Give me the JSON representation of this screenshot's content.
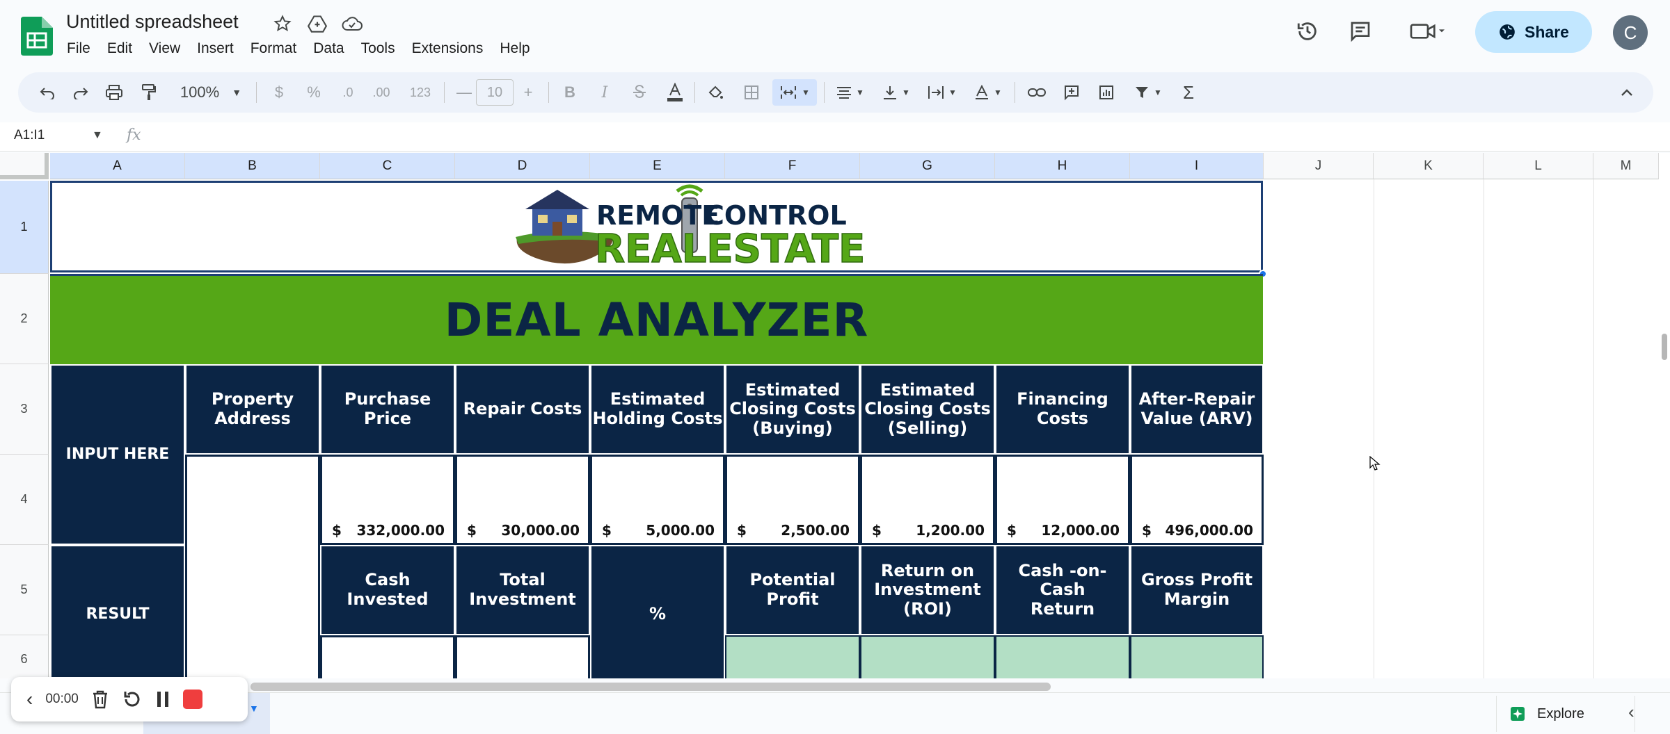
{
  "app": {
    "title": "Untitled spreadsheet",
    "menu": [
      "File",
      "Edit",
      "View",
      "Insert",
      "Format",
      "Data",
      "Tools",
      "Extensions",
      "Help"
    ],
    "share_label": "Share",
    "avatar_initial": "C"
  },
  "toolbar": {
    "zoom": "100%",
    "currency": "$",
    "percent": "%",
    "dec_decrease": ".0",
    "dec_increase": ".00",
    "number_format": "123",
    "minus": "—",
    "font_size": "10",
    "plus": "+",
    "bold": "B",
    "italic": "I"
  },
  "formula_bar": {
    "name_box": "A1:I1",
    "fx": "fx"
  },
  "columns": [
    "A",
    "B",
    "C",
    "D",
    "E",
    "F",
    "G",
    "H",
    "I",
    "J",
    "K",
    "L",
    "M"
  ],
  "rows": [
    "1",
    "2",
    "3",
    "4",
    "5",
    "6"
  ],
  "sheet": {
    "banner_title": "DEAL ANALYZER",
    "logo": {
      "line1": "REMOTE CONTROL",
      "line2": "REALESTATE"
    },
    "input_label": "INPUT HERE",
    "result_label": "RESULT",
    "input_headers": [
      "Property Address",
      "Purchase Price",
      "Repair Costs",
      "Estimated Holding Costs",
      "Estimated Closing Costs (Buying)",
      "Estimated Closing Costs (Selling)",
      "Financing Costs",
      "After-Repair Value (ARV)"
    ],
    "input_values": [
      {
        "sym": "$",
        "val": "332,000.00"
      },
      {
        "sym": "$",
        "val": "30,000.00"
      },
      {
        "sym": "$",
        "val": "5,000.00"
      },
      {
        "sym": "$",
        "val": "2,500.00"
      },
      {
        "sym": "$",
        "val": "1,200.00"
      },
      {
        "sym": "$",
        "val": "12,000.00"
      },
      {
        "sym": "$",
        "val": "496,000.00"
      }
    ],
    "result_headers": [
      "Cash Invested",
      "Total Investment",
      "%",
      "Potential Profit",
      "Return on Investment (ROI)",
      "Cash -on- Cash Return",
      "Gross Profit Margin"
    ]
  },
  "recorder": {
    "time": "00:00"
  },
  "bottom": {
    "explore_label": "Explore"
  },
  "colors": {
    "navy": "#0b2545",
    "green": "#55a717",
    "result_green": "#b3dfc5",
    "share_bg": "#c2e7ff"
  }
}
